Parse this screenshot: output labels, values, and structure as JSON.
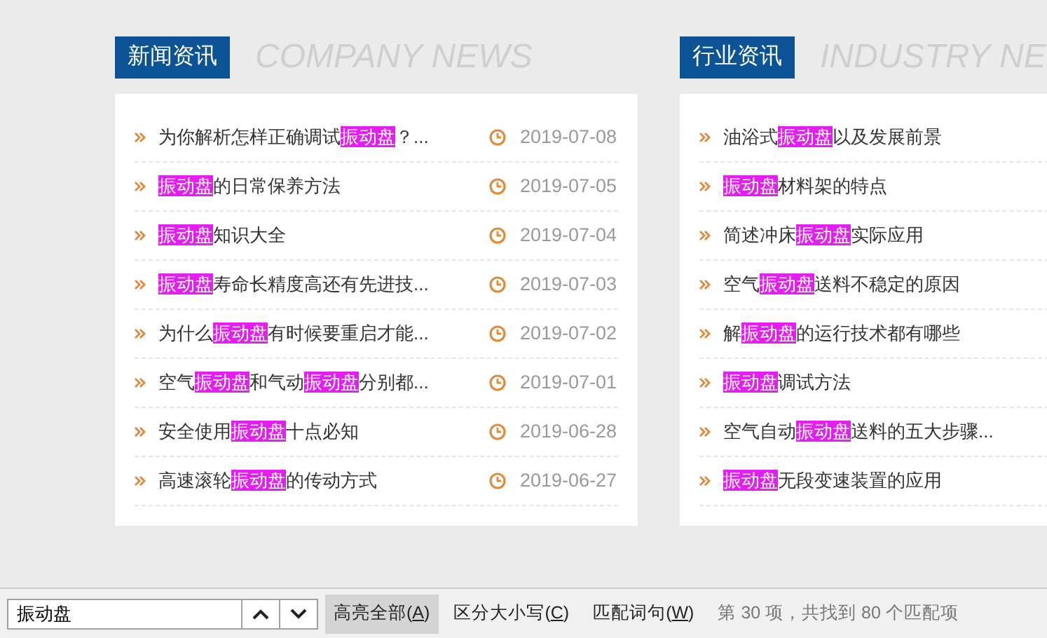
{
  "sections": [
    {
      "title": "新闻资讯",
      "subtitle": "COMPANY NEWS",
      "items": [
        {
          "parts": [
            {
              "text": "为你解析怎样正确调试",
              "highlight": false
            },
            {
              "text": "振动盘",
              "highlight": true
            },
            {
              "text": "？...",
              "highlight": false
            }
          ],
          "date": "2019-07-08"
        },
        {
          "parts": [
            {
              "text": "振动盘",
              "highlight": true
            },
            {
              "text": "的日常保养方法",
              "highlight": false
            }
          ],
          "date": "2019-07-05"
        },
        {
          "parts": [
            {
              "text": "振动盘",
              "highlight": true
            },
            {
              "text": "知识大全",
              "highlight": false
            }
          ],
          "date": "2019-07-04"
        },
        {
          "parts": [
            {
              "text": "振动盘",
              "highlight": true
            },
            {
              "text": "寿命长精度高还有先进技...",
              "highlight": false
            }
          ],
          "date": "2019-07-03"
        },
        {
          "parts": [
            {
              "text": "为什么",
              "highlight": false
            },
            {
              "text": "振动盘",
              "highlight": true
            },
            {
              "text": "有时候要重启才能...",
              "highlight": false
            }
          ],
          "date": "2019-07-02"
        },
        {
          "parts": [
            {
              "text": "空气",
              "highlight": false
            },
            {
              "text": "振动盘",
              "highlight": true
            },
            {
              "text": "和气动",
              "highlight": false
            },
            {
              "text": "振动盘",
              "highlight": true
            },
            {
              "text": "分别都...",
              "highlight": false
            }
          ],
          "date": "2019-07-01"
        },
        {
          "parts": [
            {
              "text": "安全使用",
              "highlight": false
            },
            {
              "text": "振动盘",
              "highlight": true
            },
            {
              "text": "十点必知",
              "highlight": false
            }
          ],
          "date": "2019-06-28"
        },
        {
          "parts": [
            {
              "text": "高速滚轮",
              "highlight": false
            },
            {
              "text": "振动盘",
              "highlight": true
            },
            {
              "text": "的传动方式",
              "highlight": false
            }
          ],
          "date": "2019-06-27"
        }
      ]
    },
    {
      "title": "行业资讯",
      "subtitle": "INDUSTRY NE",
      "items": [
        {
          "parts": [
            {
              "text": "油浴式",
              "highlight": false
            },
            {
              "text": "振动盘",
              "highlight": true
            },
            {
              "text": "以及发展前景",
              "highlight": false
            }
          ]
        },
        {
          "parts": [
            {
              "text": "振动盘",
              "highlight": true
            },
            {
              "text": "材料架的特点",
              "highlight": false
            }
          ]
        },
        {
          "parts": [
            {
              "text": "简述冲床",
              "highlight": false
            },
            {
              "text": "振动盘",
              "highlight": true
            },
            {
              "text": "实际应用",
              "highlight": false
            }
          ]
        },
        {
          "parts": [
            {
              "text": "空气",
              "highlight": false
            },
            {
              "text": "振动盘",
              "highlight": true
            },
            {
              "text": "送料不稳定的原因",
              "highlight": false
            }
          ]
        },
        {
          "parts": [
            {
              "text": "解",
              "highlight": false
            },
            {
              "text": "振动盘",
              "highlight": true
            },
            {
              "text": "的运行技术都有哪些",
              "highlight": false
            }
          ]
        },
        {
          "parts": [
            {
              "text": "振动盘",
              "highlight": true
            },
            {
              "text": "调试方法",
              "highlight": false
            }
          ]
        },
        {
          "parts": [
            {
              "text": "空气自动",
              "highlight": false
            },
            {
              "text": "振动盘",
              "highlight": true
            },
            {
              "text": "送料的五大步骤...",
              "highlight": false
            }
          ]
        },
        {
          "parts": [
            {
              "text": "振动盘",
              "highlight": true
            },
            {
              "text": "无段变速装置的应用",
              "highlight": false
            }
          ]
        }
      ]
    }
  ],
  "find_bar": {
    "value": "振动盘",
    "options": [
      {
        "prefix": "高亮全部(",
        "key": "A",
        "suffix": ")",
        "selected": true
      },
      {
        "prefix": "区分大小写(",
        "key": "C",
        "suffix": ")",
        "selected": false
      },
      {
        "prefix": "匹配词句(",
        "key": "W",
        "suffix": ")",
        "selected": false
      }
    ],
    "status": "第 30 项，共找到 80 个匹配项"
  }
}
